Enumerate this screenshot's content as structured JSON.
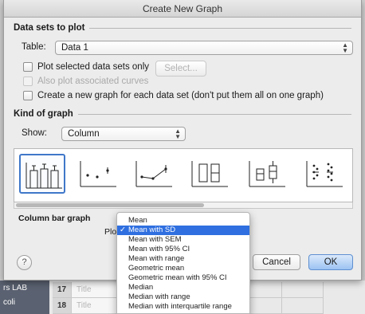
{
  "window": {
    "title": "Create New Graph"
  },
  "datasets": {
    "header": "Data sets to plot",
    "table_label": "Table:",
    "table_value": "Data 1",
    "plot_selected_label": "Plot selected data sets only",
    "select_button": "Select...",
    "also_plot_label": "Also plot associated curves",
    "new_graph_label": "Create a new graph for each data set (don't put them all on one graph)"
  },
  "kind": {
    "header": "Kind of graph",
    "show_label": "Show:",
    "show_value": "Column",
    "description": "Column bar graph",
    "plot_label": "Plo"
  },
  "buttons": {
    "help": "?",
    "cancel": "Cancel",
    "ok": "OK"
  },
  "menu": {
    "items": [
      "Mean",
      "Mean with SD",
      "Mean with SEM",
      "Mean with 95% CI",
      "Mean with range",
      "Geometric mean",
      "Geometric mean with 95% CI",
      "Median",
      "Median with range",
      "Median with interquartile range"
    ],
    "selected": "Mean with SD",
    "tick": "✓"
  },
  "sheet": {
    "rows": [
      {
        "nav": "rs LAB",
        "num": "17",
        "title": "Title"
      },
      {
        "nav": "coli",
        "num": "18",
        "title": "Title"
      }
    ]
  },
  "colors": {
    "accent": "#3f77c9",
    "menu_highlight": "#2f6fe0"
  }
}
